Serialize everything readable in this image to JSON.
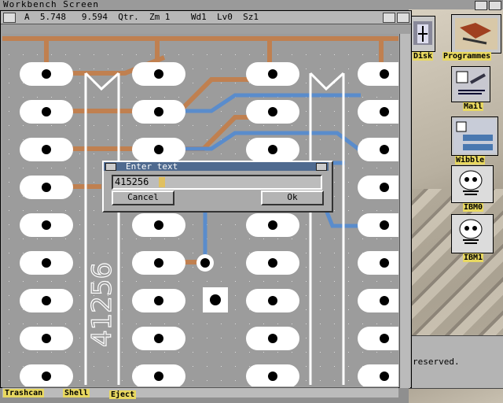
{
  "screen": {
    "title": "Workbench Screen"
  },
  "editor": {
    "status_bar": "A  5.748   9.594  Qtr.  Zm 1    Wd1  Lv0  Sz1",
    "chip_label": "41256"
  },
  "dialog": {
    "title": "Enter text",
    "input_value": "415256",
    "cancel_label": "Cancel",
    "ok_label": "Ok"
  },
  "icons": [
    {
      "label": "Disk"
    },
    {
      "label": "Programmes"
    },
    {
      "label": "Mail"
    },
    {
      "label": "Wibble"
    },
    {
      "label": "IBM0"
    },
    {
      "label": "IBM1"
    }
  ],
  "taskbar": {
    "trashcan": "Trashcan",
    "shell": "Shell",
    "eject": "Eject"
  },
  "cli": {
    "text": "reserved."
  },
  "colors": {
    "trace_copper": "#c08050",
    "trace_blue": "#5a8ccc",
    "pad": "#ffffff",
    "titlebar": "#4f6a8f"
  }
}
